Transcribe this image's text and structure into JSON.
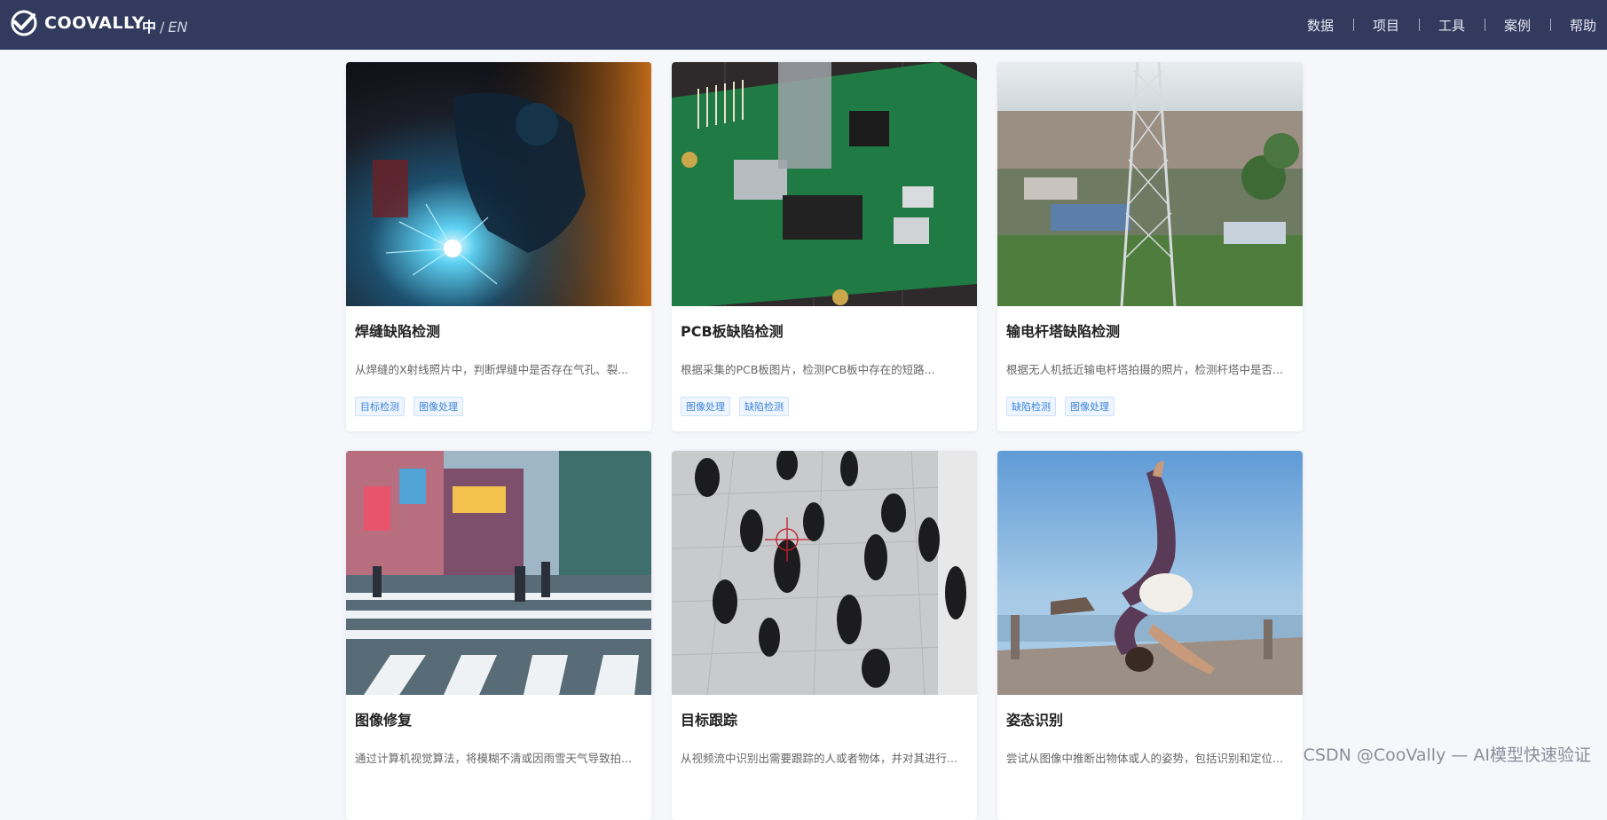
{
  "header": {
    "logo_text": "COOVALLY",
    "lang_zh": "中",
    "lang_sep": "/",
    "lang_en": "EN",
    "nav": [
      "数据",
      "项目",
      "工具",
      "案例",
      "帮助"
    ]
  },
  "cards": [
    {
      "title": "焊缝缺陷检测",
      "desc": "从焊缝的X射线照片中，判断焊缝中是否存在气孔、裂...",
      "tags": [
        "目标检测",
        "图像处理"
      ]
    },
    {
      "title": "PCB板缺陷检测",
      "desc": "根据采集的PCB板图片，检测PCB板中存在的短路...",
      "tags": [
        "图像处理",
        "缺陷检测"
      ]
    },
    {
      "title": "输电杆塔缺陷检测",
      "desc": "根据无人机抵近输电杆塔拍摄的照片，检测杆塔中是否...",
      "tags": [
        "缺陷检测",
        "图像处理"
      ]
    },
    {
      "title": "图像修复",
      "desc": "通过计算机视觉算法，将模糊不清或因雨雪天气导致拍...",
      "tags": []
    },
    {
      "title": "目标跟踪",
      "desc": "从视频流中识别出需要跟踪的人或者物体，并对其进行...",
      "tags": []
    },
    {
      "title": "姿态识别",
      "desc": "尝试从图像中推断出物体或人的姿势，包括识别和定位...",
      "tags": []
    }
  ],
  "watermark": "CSDN @CooVally — AI模型快速验证",
  "colors": {
    "header_bg": "#323a5e",
    "tag_text": "#3f85d8",
    "page_bg": "#f5f7fb"
  }
}
